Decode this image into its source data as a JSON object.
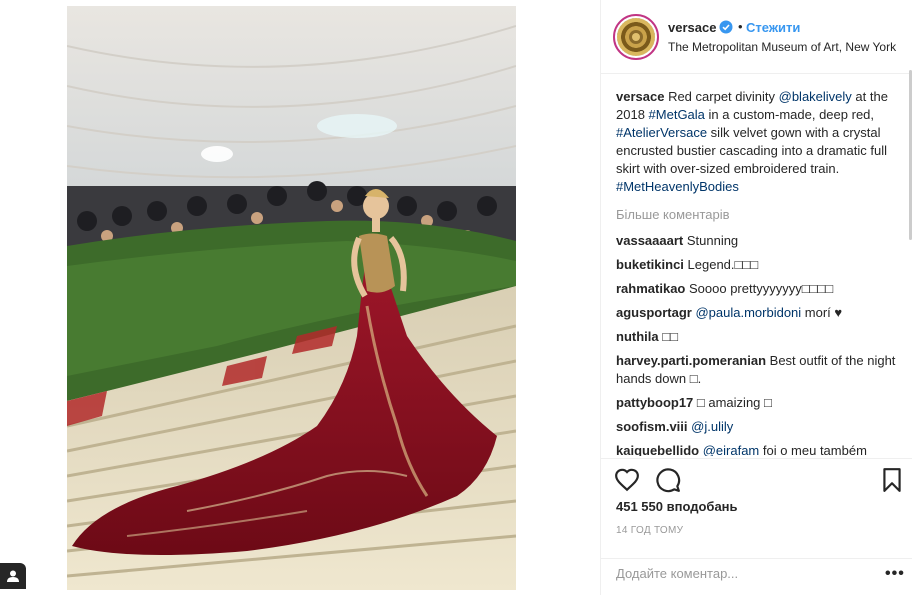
{
  "post": {
    "image_alt": "Blake Lively in red velvet gown on Met Gala stairs",
    "header": {
      "username": "versace",
      "separator": "•",
      "follow_label": "Стежити",
      "location": "The Metropolitan Museum of Art, New York"
    },
    "caption": {
      "username": "versace",
      "parts": [
        {
          "text": " Red carpet divinity ",
          "tag": false
        },
        {
          "text": "@blakelively",
          "tag": true
        },
        {
          "text": " at the 2018 ",
          "tag": false
        },
        {
          "text": "#MetGala",
          "tag": true
        },
        {
          "text": " in a custom-made, deep red, ",
          "tag": false
        },
        {
          "text": "#AtelierVersace",
          "tag": true
        },
        {
          "text": " silk velvet gown with a crystal encrusted bustier cascading into a dramatic full skirt with over-sized embroidered train. ",
          "tag": false
        },
        {
          "text": "#MetHeavenlyBodies",
          "tag": true
        }
      ]
    },
    "more_comments_label": "Більше коментарів",
    "comments": [
      {
        "user": "vassaaaart",
        "parts": [
          {
            "text": " Stunning",
            "tag": false
          }
        ]
      },
      {
        "user": "buketikinci",
        "parts": [
          {
            "text": " Legend.□□□",
            "tag": false
          }
        ]
      },
      {
        "user": "rahmatikao",
        "parts": [
          {
            "text": " Soooo prettyyyyyyy□□□□",
            "tag": false
          }
        ]
      },
      {
        "user": "agusportagr",
        "parts": [
          {
            "text": " ",
            "tag": false
          },
          {
            "text": "@paula.morbidoni",
            "tag": true
          },
          {
            "text": " morí ♥",
            "tag": false
          }
        ]
      },
      {
        "user": "nuthila",
        "parts": [
          {
            "text": " □□",
            "tag": false
          }
        ]
      },
      {
        "user": "harvey.parti.pomeranian",
        "parts": [
          {
            "text": " Best outfit of the night hands down □.",
            "tag": false
          }
        ]
      },
      {
        "user": "pattyboop17",
        "parts": [
          {
            "text": " □ amaizing □",
            "tag": false
          }
        ]
      },
      {
        "user": "soofism.viii",
        "parts": [
          {
            "text": " ",
            "tag": false
          },
          {
            "text": "@j.ulily",
            "tag": true
          }
        ]
      },
      {
        "user": "kaiquebellido",
        "parts": [
          {
            "text": " ",
            "tag": false
          },
          {
            "text": "@eirafam",
            "tag": true
          },
          {
            "text": " foi o meu também",
            "tag": false
          }
        ]
      }
    ],
    "likes_label": "451 550 вподобань",
    "time_label": "14 ГОД ТОМУ",
    "add_comment_placeholder": "Додайте коментар...",
    "more_options_label": "•••"
  },
  "colors": {
    "link": "#003569",
    "follow": "#3897f0",
    "gown": "#8b0f1e",
    "muted": "#999999"
  },
  "icons": [
    "heart-icon",
    "comment-icon",
    "bookmark-icon",
    "verified-badge-icon",
    "user-icon"
  ]
}
